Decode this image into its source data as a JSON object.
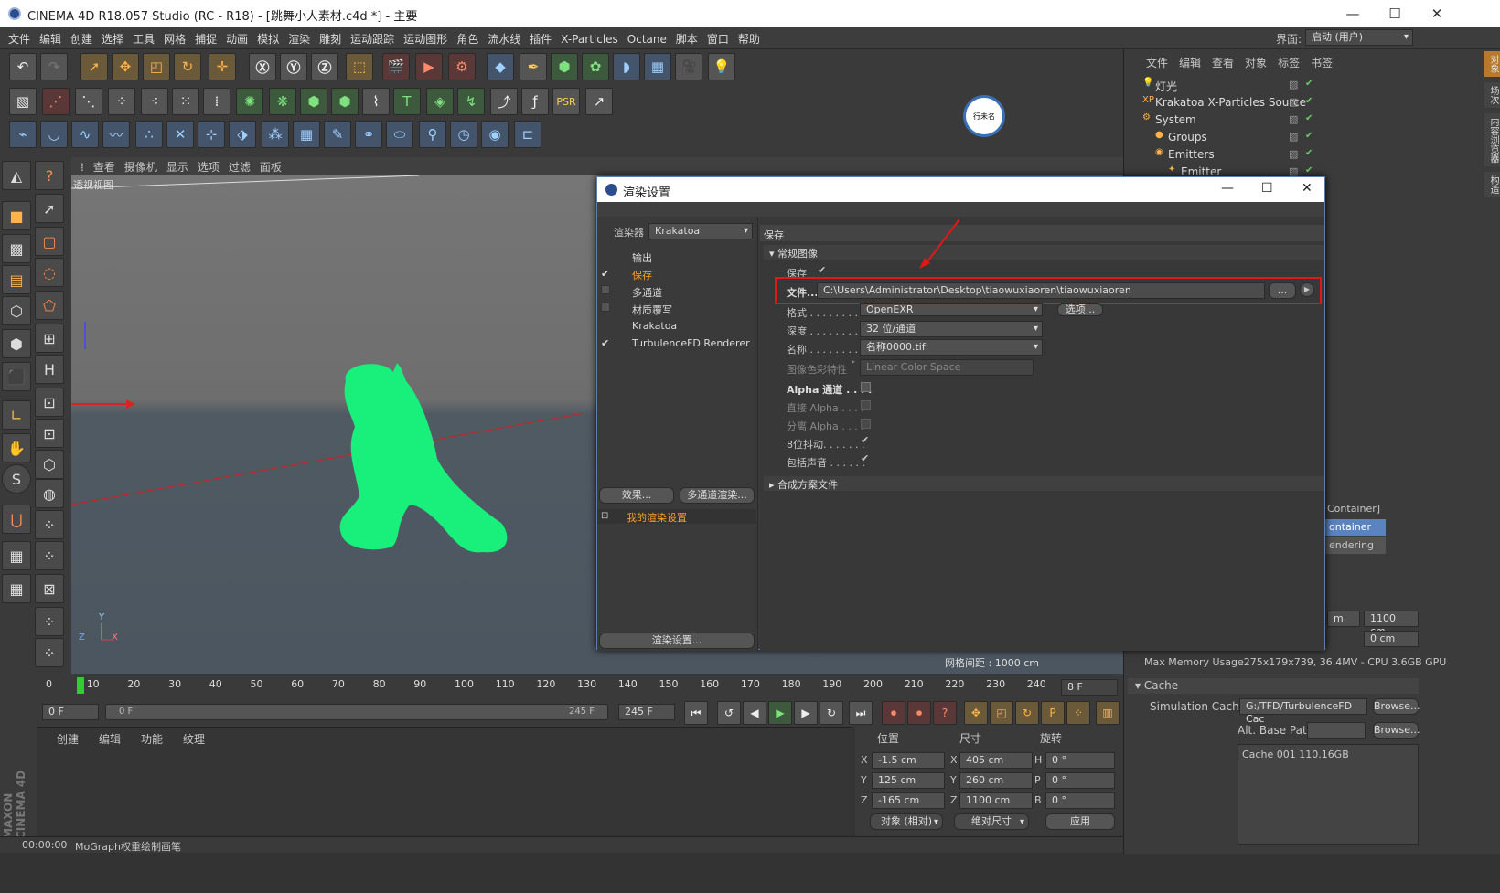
{
  "window": {
    "title": "CINEMA 4D R18.057 Studio (RC - R18) - [跳舞小人素材.c4d *] - 主要",
    "min": "—",
    "max": "☐",
    "close": "✕"
  },
  "menu": [
    "文件",
    "编辑",
    "创建",
    "选择",
    "工具",
    "网格",
    "捕捉",
    "动画",
    "模拟",
    "渲染",
    "雕刻",
    "运动跟踪",
    "运动图形",
    "角色",
    "流水线",
    "插件",
    "X-Particles",
    "Octane",
    "脚本",
    "窗口",
    "帮助"
  ],
  "layout": {
    "label": "界面:",
    "value": "启动 (用户)"
  },
  "viewport_menu": [
    "查看",
    "摄像机",
    "显示",
    "选项",
    "过滤",
    "面板"
  ],
  "viewport": {
    "label": "透视视图",
    "grid_spacing": "网格间距 : 1000 cm",
    "axes": {
      "y": "Y",
      "z": "Z",
      "x": "X"
    }
  },
  "timeline": {
    "ticks": [
      "0",
      "10",
      "20",
      "30",
      "40",
      "50",
      "60",
      "70",
      "80",
      "90",
      "100",
      "110",
      "120",
      "130",
      "140",
      "150",
      "160",
      "170",
      "180",
      "190",
      "200",
      "210",
      "220",
      "230",
      "240"
    ],
    "current": "8 F",
    "start": "0 F",
    "range_start": "0 F",
    "range_end": "245 F",
    "end": "245 F"
  },
  "materials_menu": [
    "创建",
    "编辑",
    "功能",
    "纹理"
  ],
  "coords": {
    "headers": [
      "位置",
      "尺寸",
      "旋转"
    ],
    "rows": [
      {
        "a": "X",
        "pos": "-1.5 cm",
        "b": "X",
        "size": "405 cm",
        "c": "H",
        "rot": "0 °"
      },
      {
        "a": "Y",
        "pos": "125 cm",
        "b": "Y",
        "size": "260 cm",
        "c": "P",
        "rot": "0 °"
      },
      {
        "a": "Z",
        "pos": "-165 cm",
        "b": "Z",
        "size": "1100 cm",
        "c": "B",
        "rot": "0 °"
      }
    ],
    "mode": "对象 (相对)",
    "size_mode": "绝对尺寸",
    "apply": "应用"
  },
  "status": {
    "time": "00:00:00",
    "text": "MoGraph权重绘制画笔"
  },
  "object_manager": {
    "menu": [
      "文件",
      "编辑",
      "查看",
      "对象",
      "标签",
      "书签"
    ],
    "items": [
      {
        "name": "灯光",
        "indent": 0
      },
      {
        "name": "Krakatoa X-Particles Source",
        "indent": 0
      },
      {
        "name": "System",
        "indent": 0
      },
      {
        "name": "Groups",
        "indent": 1
      },
      {
        "name": "Emitters",
        "indent": 1
      },
      {
        "name": "Emitter",
        "indent": 2
      }
    ]
  },
  "side_tabs": [
    "对象",
    "场次",
    "内容浏览器",
    "构造"
  ],
  "attributes": {
    "container": "Container]",
    "tab1": "ontainer",
    "tab2": "endering",
    "f1": "m",
    "f2": "1100 cm",
    "f3": "0 cm",
    "memory": "Max Memory Usage275x179x739, 36.4MV - CPU 3.6GB GPU",
    "cache_header": "Cache",
    "sim_label": "Simulation Caches",
    "sim_value": "G:/TFD/TurbulenceFD Cac",
    "browse": "Browse...",
    "alt_label": "Alt. Base Path",
    "cache_item": "Cache 001 110.16GB"
  },
  "logo_text": "行未名",
  "dialog": {
    "title": "渲染设置",
    "renderer_label": "渲染器",
    "renderer": "Krakatoa",
    "nav": [
      {
        "label": "输出",
        "checked": false,
        "cb": false
      },
      {
        "label": "保存",
        "checked": true,
        "cb": true,
        "active": true
      },
      {
        "label": "多通道",
        "checked": false,
        "cb": true
      },
      {
        "label": "材质覆写",
        "checked": false,
        "cb": true
      },
      {
        "label": "Krakatoa",
        "checked": false,
        "cb": false
      },
      {
        "label": "TurbulenceFD Renderer",
        "checked": true,
        "cb": true
      }
    ],
    "effects_btn": "效果...",
    "multipass_btn": "多通道渲染...",
    "my_settings": "我的渲染设置",
    "render_settings_btn": "渲染设置...",
    "section": "保存",
    "group": "常规图像",
    "save_label": "保存",
    "file_label": "文件...",
    "file_path": "C:\\Users\\Administrator\\Desktop\\tiaowuxiaoren\\tiaowuxiaoren",
    "browse": "...",
    "format_label": "格式 . . . . . . . . .",
    "format": "OpenEXR",
    "options_btn": "选项...",
    "depth_label": "深度 . . . . . . . . .",
    "depth": "32 位/通道",
    "name_label": "名称 . . . . . . . . .",
    "name": "名称0000.tif",
    "colorspace_label": "图像色彩特性",
    "colorspace": "Linear Color Space",
    "alpha_label": "Alpha 通道 . . . .",
    "straight_label": "直接 Alpha . . . .",
    "separate_label": "分离 Alpha . . . .",
    "dither_label": "8位抖动. . . . . . .",
    "sound_label": "包括声音 . . . . . .",
    "comp_label": "合成方案文件"
  }
}
